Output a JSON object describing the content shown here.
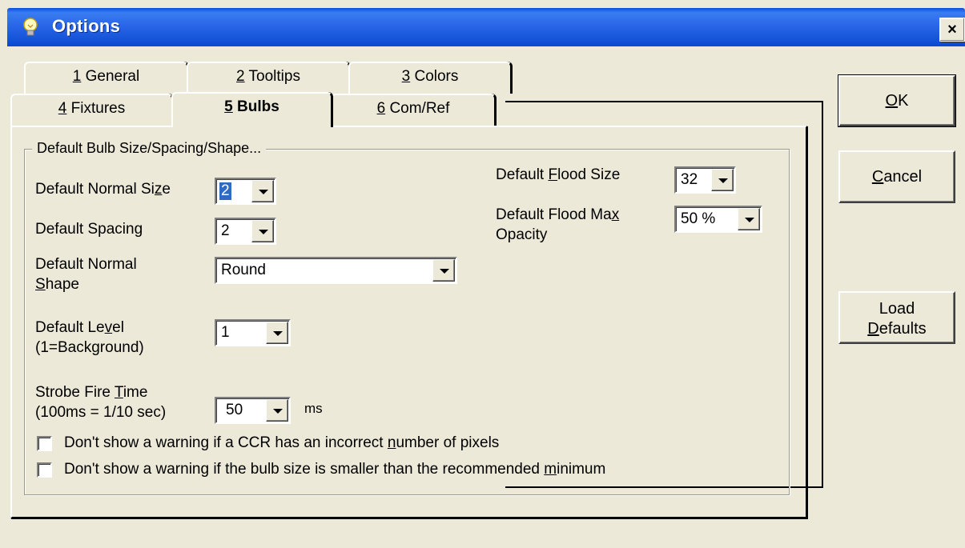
{
  "window": {
    "title": "Options",
    "close_label": "×"
  },
  "tabs": [
    {
      "num": "1",
      "label": "General"
    },
    {
      "num": "2",
      "label": "Tooltips"
    },
    {
      "num": "3",
      "label": "Colors"
    },
    {
      "num": "4",
      "label": "Fixtures"
    },
    {
      "num": "5",
      "label": "Bulbs"
    },
    {
      "num": "6",
      "label": "Com/Ref"
    }
  ],
  "group": {
    "legend": "Default Bulb Size/Spacing/Shape..."
  },
  "fields": {
    "normal_size": {
      "label_a": "Default Normal Si",
      "label_u": "z",
      "label_b": "e",
      "value": "2"
    },
    "spacing": {
      "label": "Default Spacing",
      "value": "2"
    },
    "normal_shape": {
      "label_line1": "Default Normal",
      "label_u": "S",
      "label_line2_rest": "hape",
      "value": "Round"
    },
    "level": {
      "label_a": "Default Le",
      "label_u": "v",
      "label_b": "el",
      "label_line2": "(1=Background)",
      "value": "1"
    },
    "strobe": {
      "label_a": "Strobe Fire ",
      "label_u": "T",
      "label_b": "ime",
      "label_line2": "(100ms = 1/10 sec)",
      "value": "50",
      "unit": "ms"
    },
    "flood_size": {
      "label_a": "Default ",
      "label_u": "F",
      "label_b": "lood Size",
      "value": "32"
    },
    "flood_opacity": {
      "label_a": "Default Flood Ma",
      "label_u": "x",
      "label_line2": "Opacity",
      "value": "50 %"
    }
  },
  "checkboxes": [
    {
      "text_a": "Don't show a warning if a CCR has an incorrect ",
      "text_u": "n",
      "text_b": "umber of pixels",
      "checked": false
    },
    {
      "text_a": "Don't show a warning if the bulb size is smaller than the recommended ",
      "text_u": "m",
      "text_b": "inimum",
      "checked": false
    }
  ],
  "buttons": {
    "ok_u": "O",
    "ok_rest": "K",
    "cancel_u": "C",
    "cancel_rest": "ancel",
    "load_line1": "Load",
    "load_u": "D",
    "load_rest": "efaults"
  }
}
